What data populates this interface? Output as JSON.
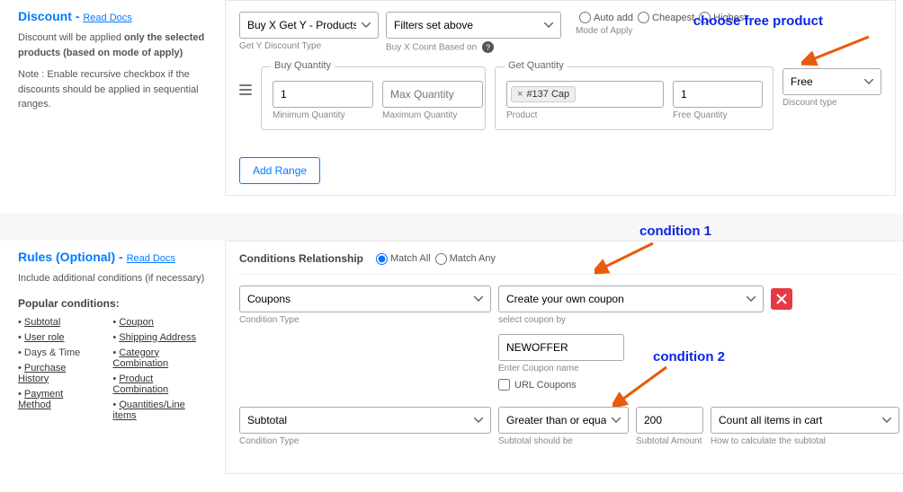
{
  "discount": {
    "title": "Discount",
    "read_docs": "Read Docs",
    "desc1": "Discount will be applied ",
    "desc1_bold": "only the selected products (based on mode of apply)",
    "desc2": "Note : Enable recursive checkbox if the discounts should be applied in sequential ranges.",
    "get_y_label": "Get Y Discount Type",
    "get_y_value": "Buy X Get Y - Products",
    "filter_label": "Buy X Count Based on",
    "filter_value": "Filters set above",
    "mode_label": "Mode of Apply",
    "mode_opts": [
      "Auto add",
      "Cheapest",
      "Highest"
    ],
    "buy_legend": "Buy Quantity",
    "buy_min_val": "1",
    "buy_max_placeholder": "Max Quantity",
    "buy_min_lbl": "Minimum Quantity",
    "buy_max_lbl": "Maximum Quantity",
    "get_legend": "Get Quantity",
    "product_chip": "#137 Cap",
    "product_lbl": "Product",
    "free_qty_val": "1",
    "free_qty_lbl": "Free Quantity",
    "disc_type_val": "Free",
    "disc_type_lbl": "Discount type",
    "add_range": "Add Range",
    "annot": "choose free product"
  },
  "rules": {
    "title": "Rules (Optional)",
    "read_docs": "Read Docs",
    "desc": "Include additional conditions (if necessary)",
    "pop_title": "Popular conditions:",
    "col1": [
      "Subtotal",
      "User role",
      "Days & Time",
      "Purchase History",
      "Payment Method"
    ],
    "col2": [
      "Coupon",
      "Shipping Address",
      "Category Combination",
      "Product Combination",
      "Quantities/Line items"
    ],
    "rel_label": "Conditions Relationship",
    "rel_opts": [
      "Match All",
      "Match Any"
    ],
    "annot1": "condition 1",
    "annot2": "condition 2",
    "c1": {
      "type": "Coupons",
      "type_lbl": "Condition Type",
      "method": "Create your own coupon",
      "method_lbl": "select coupon by",
      "coupon_val": "NEWOFFER",
      "coupon_lbl": "Enter Coupon name",
      "url_cb": "URL Coupons"
    },
    "c2": {
      "type": "Subtotal",
      "type_lbl": "Condition Type",
      "op": "Greater than or equal ( >= )",
      "op_lbl": "Subtotal should be",
      "amount": "200",
      "amount_lbl": "Subtotal Amount",
      "calc": "Count all items in cart",
      "calc_lbl": "How to calculate the subtotal"
    }
  }
}
